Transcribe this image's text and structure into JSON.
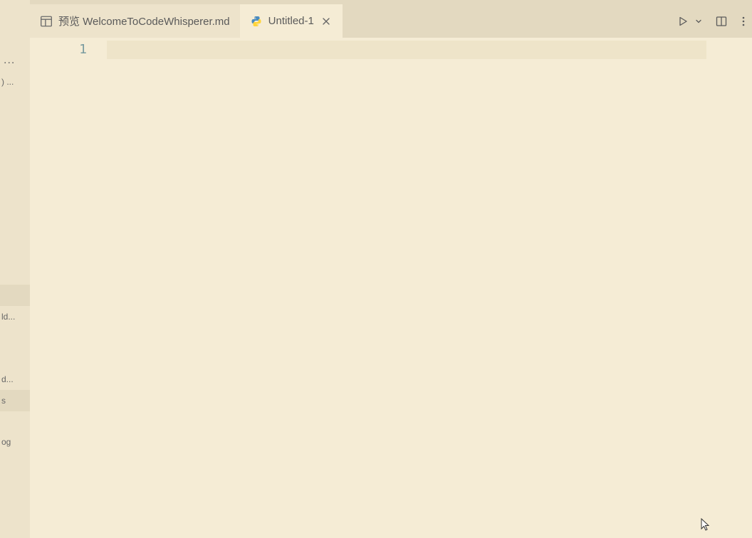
{
  "sidebar": {
    "items": [
      {
        "label": "..."
      },
      {
        "label": ") ..."
      },
      {
        "label": ""
      },
      {
        "label": "ld..."
      },
      {
        "label": "d..."
      },
      {
        "label": "s"
      },
      {
        "label": "og"
      }
    ]
  },
  "tabs": [
    {
      "icon": "preview-icon",
      "label": "预览 WelcomeToCodeWhisperer.md",
      "active": false,
      "closable": false
    },
    {
      "icon": "python-icon",
      "label": "Untitled-1",
      "active": true,
      "closable": true
    }
  ],
  "toolbar": {
    "run_tooltip": "Run",
    "split_tooltip": "Split Editor",
    "more_tooltip": "More Actions"
  },
  "editor": {
    "line_numbers": [
      "1"
    ],
    "content": [
      ""
    ]
  }
}
